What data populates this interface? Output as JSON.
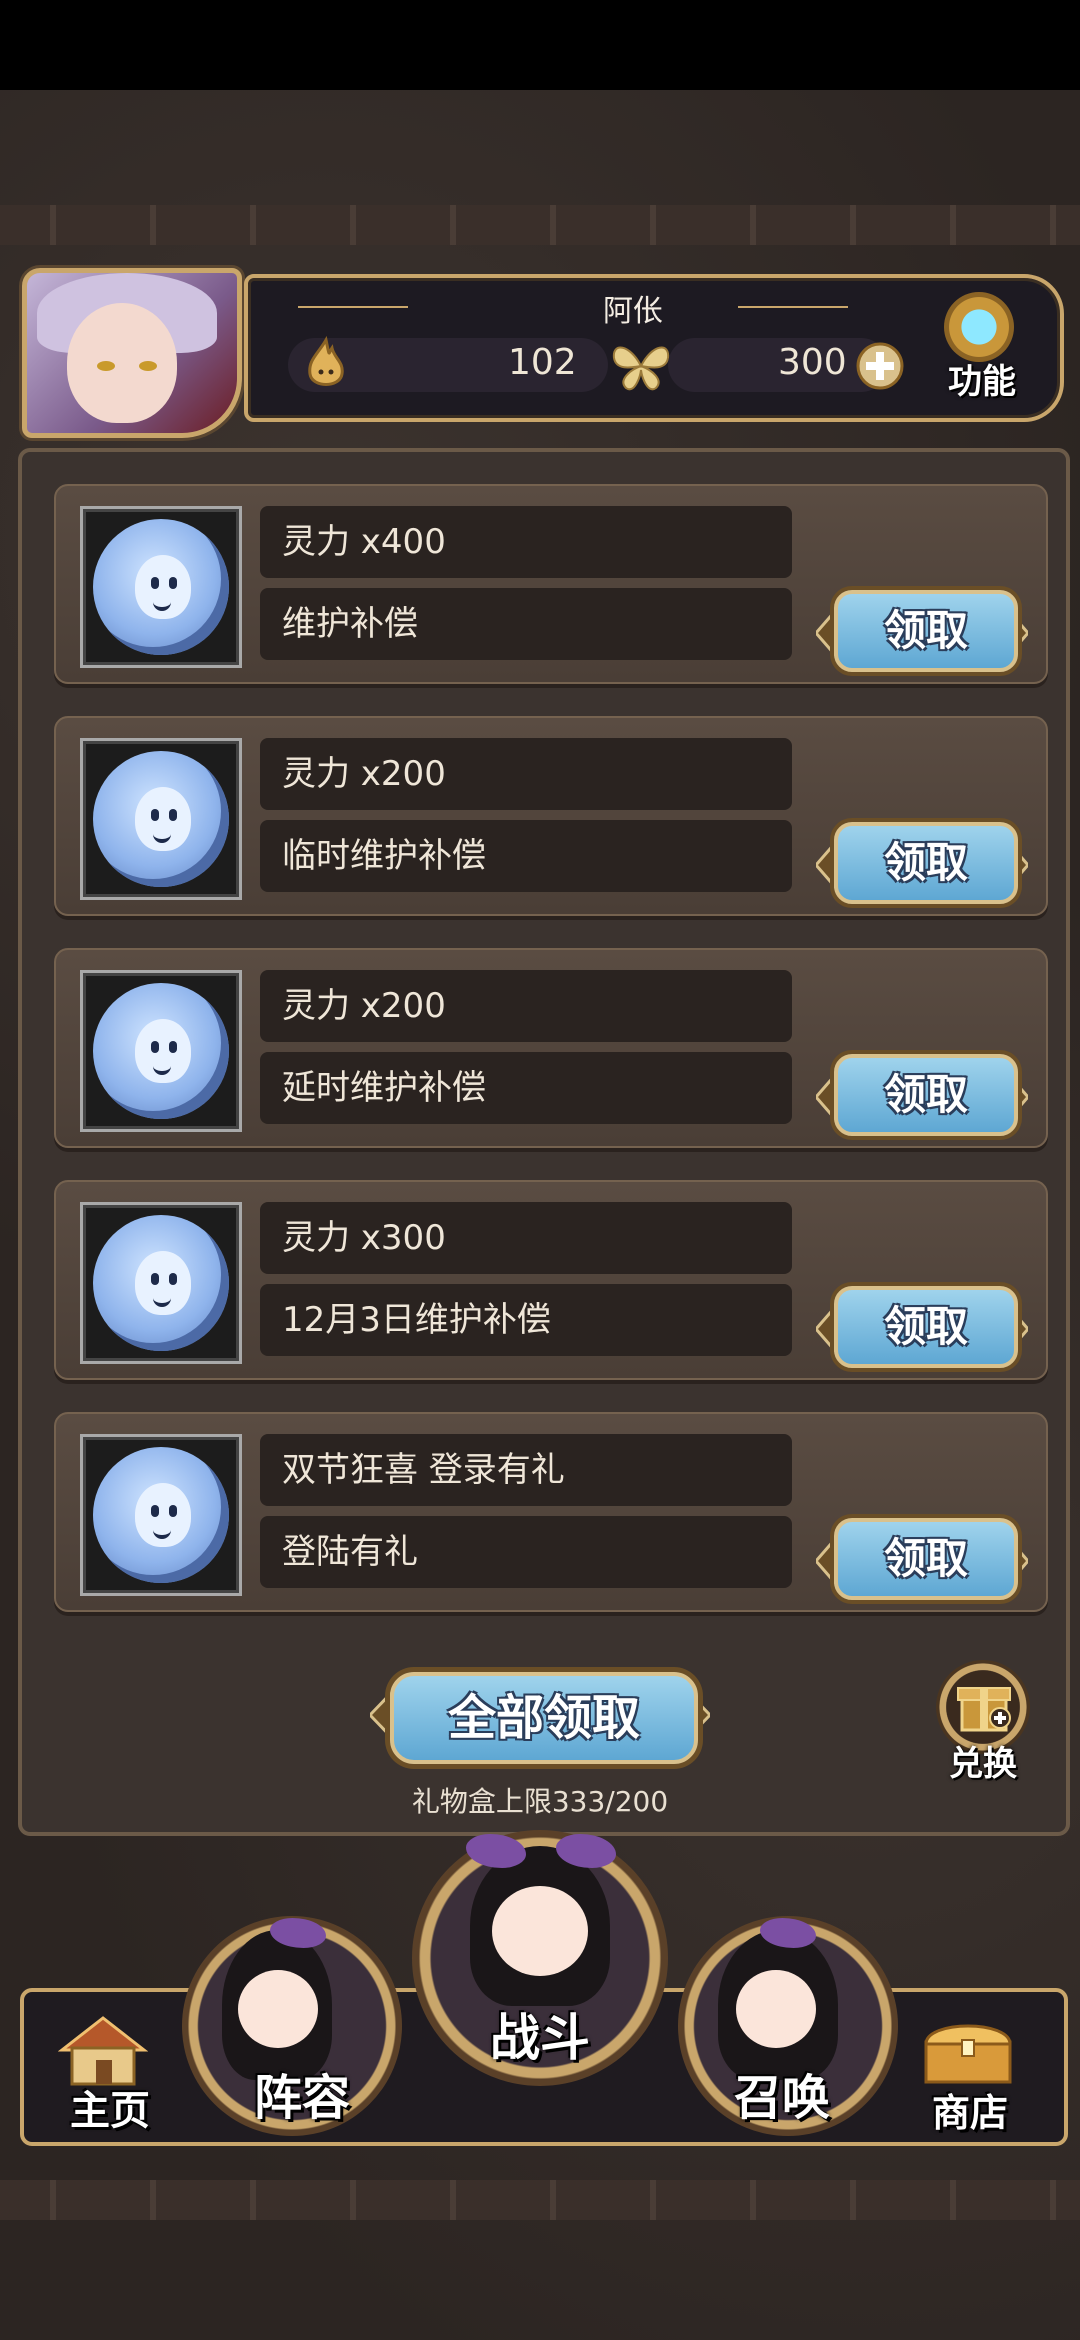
{
  "header": {
    "player_name": "阿伥",
    "currency_1": "102",
    "currency_2": "300",
    "function_label": "功能"
  },
  "gifts": [
    {
      "title": "灵力 x400",
      "desc": "维护补偿",
      "button": "领取"
    },
    {
      "title": "灵力 x200",
      "desc": "临时维护补偿",
      "button": "领取"
    },
    {
      "title": "灵力 x200",
      "desc": "延时维护补偿",
      "button": "领取"
    },
    {
      "title": "灵力 x300",
      "desc": "12月3日维护补偿",
      "button": "领取"
    },
    {
      "title": "双节狂喜 登录有礼",
      "desc": "登陆有礼",
      "button": "领取"
    }
  ],
  "claim_all_label": "全部领取",
  "gift_limit_text": "礼物盒上限333/200",
  "exchange_label": "兑换",
  "nav": {
    "home": "主页",
    "team": "阵容",
    "battle": "战斗",
    "summon": "召唤",
    "shop": "商店"
  },
  "colors": {
    "button_blue": "#5ea7d3",
    "frame_gold": "#c9a66b",
    "panel_brown": "#3b332f"
  }
}
